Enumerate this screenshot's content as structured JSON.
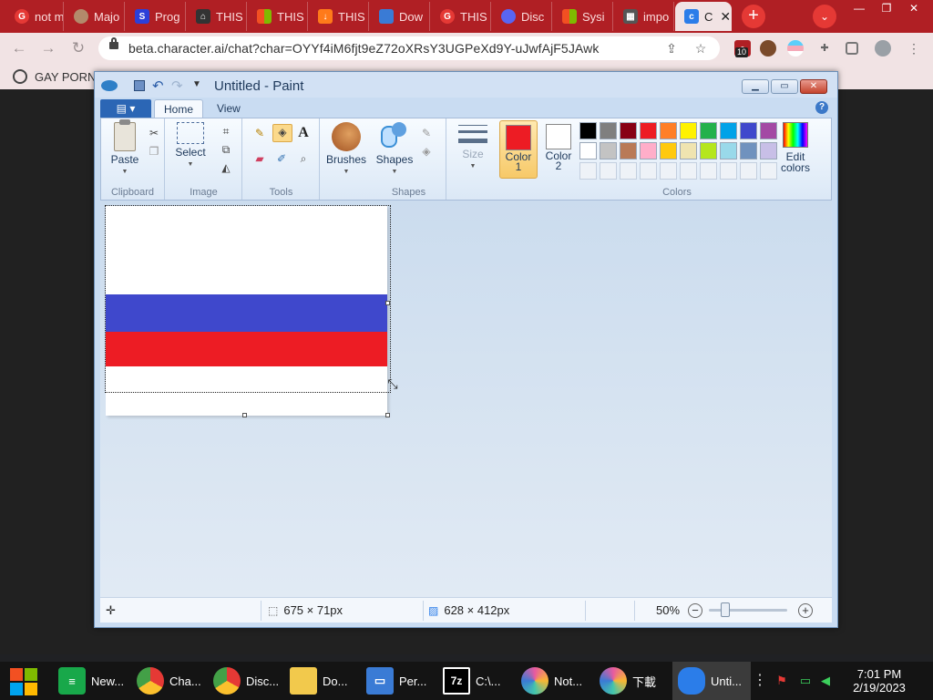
{
  "browser": {
    "tabs": [
      {
        "title": "not m",
        "icon": "google-icon",
        "color": "#e53935"
      },
      {
        "title": "Majo",
        "icon": "profile-icon",
        "color": "#b38a6b"
      },
      {
        "title": "Prog",
        "icon": "s-logo-icon",
        "color": "#2c3fd8"
      },
      {
        "title": "THIS",
        "icon": "institution-icon",
        "color": "#333333"
      },
      {
        "title": "THIS",
        "icon": "microsoft-icon",
        "color": "#f25022"
      },
      {
        "title": "THIS",
        "icon": "download-arrow-icon",
        "color": "#ff7a1a"
      },
      {
        "title": "Dow",
        "icon": "document-icon",
        "color": "#3a7bd5"
      },
      {
        "title": "THIS",
        "icon": "google-icon",
        "color": "#e53935"
      },
      {
        "title": "Disc",
        "icon": "discord-icon",
        "color": "#5865f2"
      },
      {
        "title": "Sysi",
        "icon": "microsoft-icon",
        "color": "#f25022"
      },
      {
        "title": "impo",
        "icon": "grid-icon",
        "color": "#555555"
      },
      {
        "title": "C",
        "icon": "character-ai-icon",
        "color": "#2b7de9",
        "active": true
      }
    ],
    "tab_close": "✕",
    "new_tab": "+",
    "tab_search": "⌄",
    "window_controls": [
      "—",
      "❐",
      "✕"
    ],
    "url": "beta.character.ai/chat?char=OYYf4iM6fjt9eZ72oXRsY3UGPeXd9Y-uJwfAjF5JAwk",
    "extension_badge": "10",
    "bookmarks": [
      {
        "label": "GAY PORN",
        "icon": "bookmark-site-icon"
      }
    ]
  },
  "paint": {
    "title": "Untitled - Paint",
    "file_menu": "▾",
    "tabs": {
      "home": "Home",
      "view": "View"
    },
    "help": "?",
    "groups": {
      "clipboard": "Clipboard",
      "image": "Image",
      "tools": "Tools",
      "shapes": "Shapes",
      "colors": "Colors"
    },
    "buttons": {
      "paste": "Paste",
      "select": "Select",
      "brushes": "Brushes",
      "shapes": "Shapes",
      "size": "Size",
      "color1_line1": "Color",
      "color1_line2": "1",
      "color2_line1": "Color",
      "color2_line2": "2",
      "edit_colors_line1": "Edit",
      "edit_colors_line2": "colors",
      "text_tool": "A"
    },
    "color1": "#ed1c24",
    "color2": "#ffffff",
    "palette_row1": [
      "#000000",
      "#7f7f7f",
      "#880015",
      "#ed1c24",
      "#ff7f27",
      "#fff200",
      "#22b14c",
      "#00a2e8",
      "#3f48cc",
      "#a349a4"
    ],
    "palette_row2": [
      "#ffffff",
      "#c3c3c3",
      "#b97a57",
      "#ffaec9",
      "#ffc90e",
      "#efe4b0",
      "#b5e61d",
      "#99d9ea",
      "#7092be",
      "#c8bfe7"
    ],
    "canvas_stripes": [
      {
        "color": "#ffffff",
        "from": 0,
        "to": 0.423
      },
      {
        "color": "#3f48cc",
        "from": 0.423,
        "to": 0.6
      },
      {
        "color": "#ed1c24",
        "from": 0.6,
        "to": 0.765
      },
      {
        "color": "#ffffff",
        "from": 0.765,
        "to": 1.0
      }
    ],
    "status": {
      "selection_size": "675 × 71px",
      "image_size": "628 × 412px",
      "zoom": "50%",
      "zoom_level": 0.35
    }
  },
  "taskbar": {
    "items": [
      {
        "label": "New...",
        "icon": "notepad-icon",
        "color": "#18a84a"
      },
      {
        "label": "Cha...",
        "icon": "chrome-icon",
        "color": "#e53935"
      },
      {
        "label": "Disc...",
        "icon": "chrome-icon",
        "color": "#e53935"
      },
      {
        "label": "Do...",
        "icon": "folder-icon",
        "color": "#f2c94c"
      },
      {
        "label": "Per...",
        "icon": "monitor-icon",
        "color": "#3a7bd5"
      },
      {
        "label": "C:\\...",
        "icon": "7zip-icon",
        "color": "#000000"
      },
      {
        "label": "Not...",
        "icon": "photos-icon",
        "color": "#e85aa0"
      },
      {
        "label": "下載",
        "icon": "photos-icon",
        "color": "#e85aa0"
      },
      {
        "label": "Unti...",
        "icon": "paint-icon",
        "color": "#2b7de9",
        "active": true
      }
    ],
    "time": "7:01 PM",
    "date": "2/19/2023"
  }
}
